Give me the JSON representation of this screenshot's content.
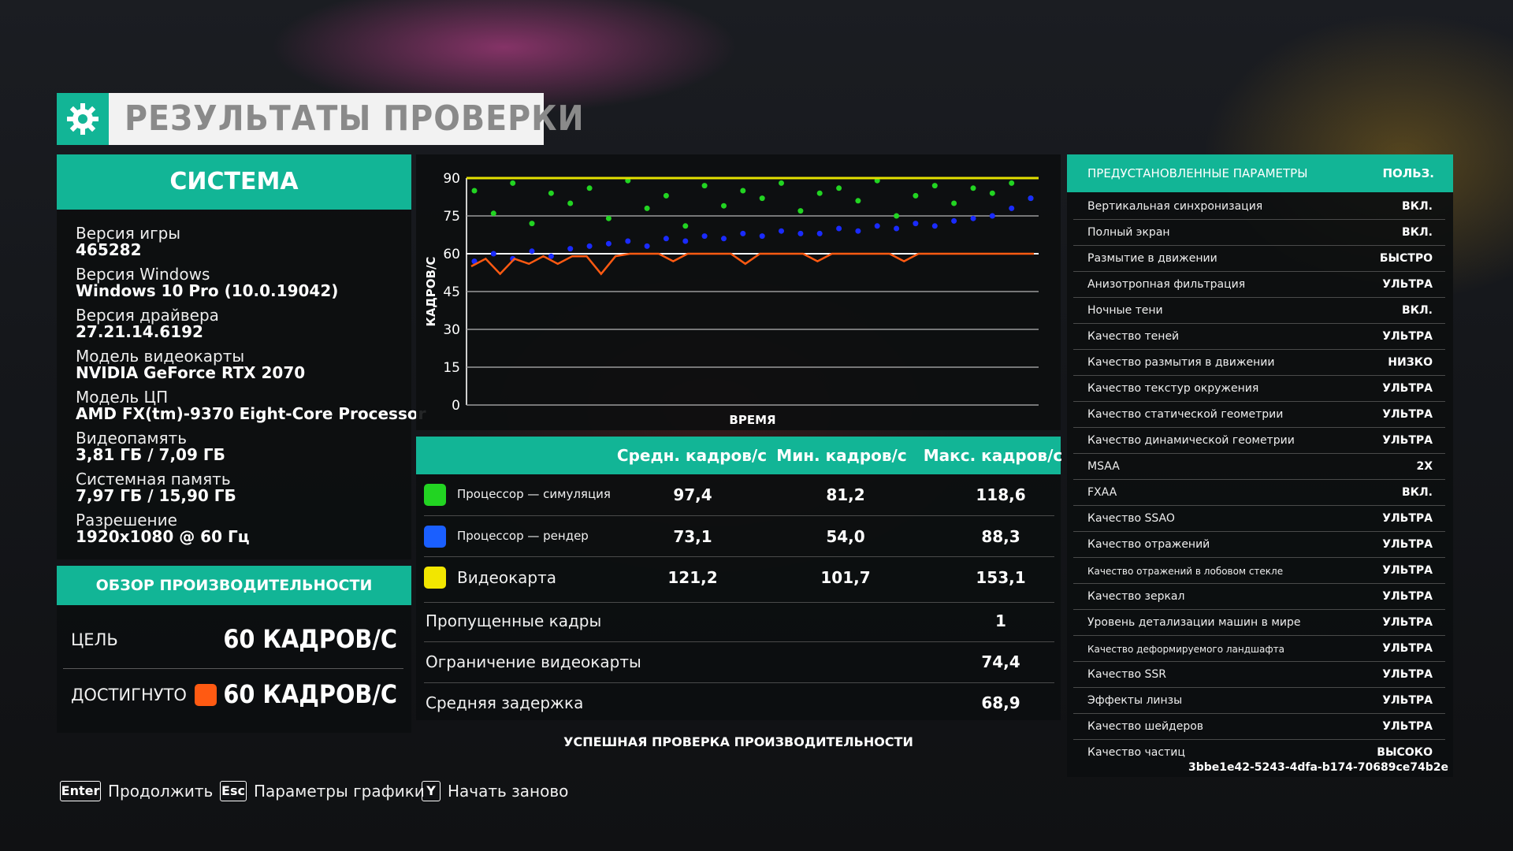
{
  "title": "РЕЗУЛЬТАТЫ ПРОВЕРКИ",
  "system": {
    "header": "СИСТЕМА",
    "items": [
      {
        "label": "Версия игры",
        "value": "465282"
      },
      {
        "label": "Версия Windows",
        "value": "Windows 10 Pro (10.0.19042)"
      },
      {
        "label": "Версия драйвера",
        "value": "27.21.14.6192"
      },
      {
        "label": "Модель видеокарты",
        "value": "NVIDIA GeForce RTX 2070"
      },
      {
        "label": "Модель ЦП",
        "value": "AMD FX(tm)-9370 Eight-Core Processor"
      },
      {
        "label": "Видеопамять",
        "value": "3,81 ГБ / 7,09 ГБ"
      },
      {
        "label": "Системная память",
        "value": "7,97 ГБ / 15,90 ГБ"
      },
      {
        "label": "Разрешение",
        "value": "1920x1080 @ 60 Гц"
      }
    ]
  },
  "performance": {
    "header": "ОБЗОР ПРОИЗВОДИТЕЛЬНОСТИ",
    "target_label": "ЦЕЛЬ",
    "target_value": "60 КАДРОВ/С",
    "achieved_label": "ДОСТИГНУТО",
    "achieved_value": "60 КАДРОВ/С",
    "achieved_color": "#ff5a12"
  },
  "chart_data": {
    "type": "scatter",
    "xlabel": "ВРЕМЯ",
    "ylabel": "КАДРОВ/С",
    "ylim": [
      0,
      90
    ],
    "yticks": [
      0,
      15,
      30,
      45,
      60,
      75,
      90
    ],
    "grid": true,
    "series": [
      {
        "name": "Процессор — симуляция",
        "color": "#22d422",
        "kind": "points",
        "values": [
          85,
          76,
          88,
          72,
          84,
          80,
          86,
          74,
          89,
          78,
          83,
          71,
          87,
          79,
          85,
          82,
          88,
          77,
          84,
          86,
          81,
          89,
          75,
          83,
          87,
          80,
          86,
          84,
          88,
          82
        ]
      },
      {
        "name": "Процессор — рендер",
        "color": "#1a2bff",
        "kind": "points",
        "values": [
          57,
          60,
          58,
          61,
          59,
          62,
          63,
          64,
          65,
          63,
          66,
          65,
          67,
          66,
          68,
          67,
          69,
          68,
          68,
          70,
          69,
          71,
          70,
          72,
          71,
          73,
          74,
          75,
          78,
          82
        ]
      },
      {
        "name": "Видеокарта",
        "color": "#e3e000",
        "kind": "points",
        "values": [
          90,
          90,
          90,
          90,
          90,
          90,
          90,
          90,
          90,
          90,
          90,
          90,
          90,
          90,
          90,
          90,
          90,
          90,
          90,
          90,
          90,
          90,
          90,
          90,
          90,
          90,
          90,
          90,
          90,
          90
        ]
      },
      {
        "name": "Достигнуто",
        "color": "#ff5a12",
        "kind": "line",
        "values": [
          55,
          58,
          52,
          58,
          56,
          59,
          56,
          59,
          59,
          52,
          59,
          60,
          60,
          60,
          57,
          60,
          60,
          60,
          60,
          56,
          60,
          60,
          60,
          60,
          57,
          60,
          60,
          60,
          60,
          60,
          57,
          60,
          60,
          60,
          60,
          60,
          60,
          60,
          60,
          60
        ]
      }
    ]
  },
  "stats": {
    "headers": {
      "avg": "Средн. кадров/с",
      "min": "Мин. кадров/с",
      "max": "Макс. кадров/с"
    },
    "rows": [
      {
        "label": "Процессор — симуляция",
        "color": "#22d422",
        "avg": "97,4",
        "min": "81,2",
        "max": "118,6"
      },
      {
        "label": "Процессор — рендер",
        "color": "#1a5fff",
        "avg": "73,1",
        "min": "54,0",
        "max": "88,3"
      },
      {
        "label": "Видеокарта",
        "color": "#f2e600",
        "avg": "121,2",
        "min": "101,7",
        "max": "153,1"
      }
    ],
    "extra": [
      {
        "label": "Пропущенные кадры",
        "value": "1"
      },
      {
        "label": "Ограничение видеокарты",
        "value": "74,4"
      },
      {
        "label": "Средняя задержка",
        "value": "68,9"
      }
    ],
    "status": "УСПЕШНАЯ ПРОВЕРКА ПРОИЗВОДИТЕЛЬНОСТИ"
  },
  "settings": {
    "header_label": "ПРЕДУСТАНОВЛЕННЫЕ ПАРАМЕТРЫ",
    "header_value": "ПОЛЬЗ.",
    "items": [
      {
        "label": "Вертикальная синхронизация",
        "value": "ВКЛ."
      },
      {
        "label": "Полный экран",
        "value": "ВКЛ."
      },
      {
        "label": "Размытие в движении",
        "value": "БЫСТРО"
      },
      {
        "label": "Анизотропная фильтрация",
        "value": "УЛЬТРА"
      },
      {
        "label": "Ночные тени",
        "value": "ВКЛ."
      },
      {
        "label": "Качество теней",
        "value": "УЛЬТРА"
      },
      {
        "label": "Качество размытия в движении",
        "value": "НИЗКО"
      },
      {
        "label": "Качество текстур окружения",
        "value": "УЛЬТРА"
      },
      {
        "label": "Качество статической геометрии",
        "value": "УЛЬТРА"
      },
      {
        "label": "Качество динамической геометрии",
        "value": "УЛЬТРА"
      },
      {
        "label": "MSAA",
        "value": "2X"
      },
      {
        "label": "FXAA",
        "value": "ВКЛ."
      },
      {
        "label": "Качество SSAO",
        "value": "УЛЬТРА"
      },
      {
        "label": "Качество отражений",
        "value": "УЛЬТРА"
      },
      {
        "label": "Качество отражений в лобовом стекле",
        "value": "УЛЬТРА"
      },
      {
        "label": "Качество зеркал",
        "value": "УЛЬТРА"
      },
      {
        "label": "Уровень детализации машин в мире",
        "value": "УЛЬТРА"
      },
      {
        "label": "Качество деформируемого ландшафта",
        "value": "УЛЬТРА"
      },
      {
        "label": "Качество SSR",
        "value": "УЛЬТРА"
      },
      {
        "label": "Эффекты линзы",
        "value": "УЛЬТРА"
      },
      {
        "label": "Качество шейдеров",
        "value": "УЛЬТРА"
      },
      {
        "label": "Качество частиц",
        "value": "ВЫСОКО"
      }
    ],
    "session_id": "3bbe1e42-5243-4dfa-b174-70689ce74b2e"
  },
  "footer": {
    "continue": {
      "key": "Enter",
      "label": "Продолжить"
    },
    "graphics": {
      "key": "Esc",
      "label": "Параметры графики"
    },
    "restart": {
      "key": "Y",
      "label": "Начать заново"
    }
  }
}
